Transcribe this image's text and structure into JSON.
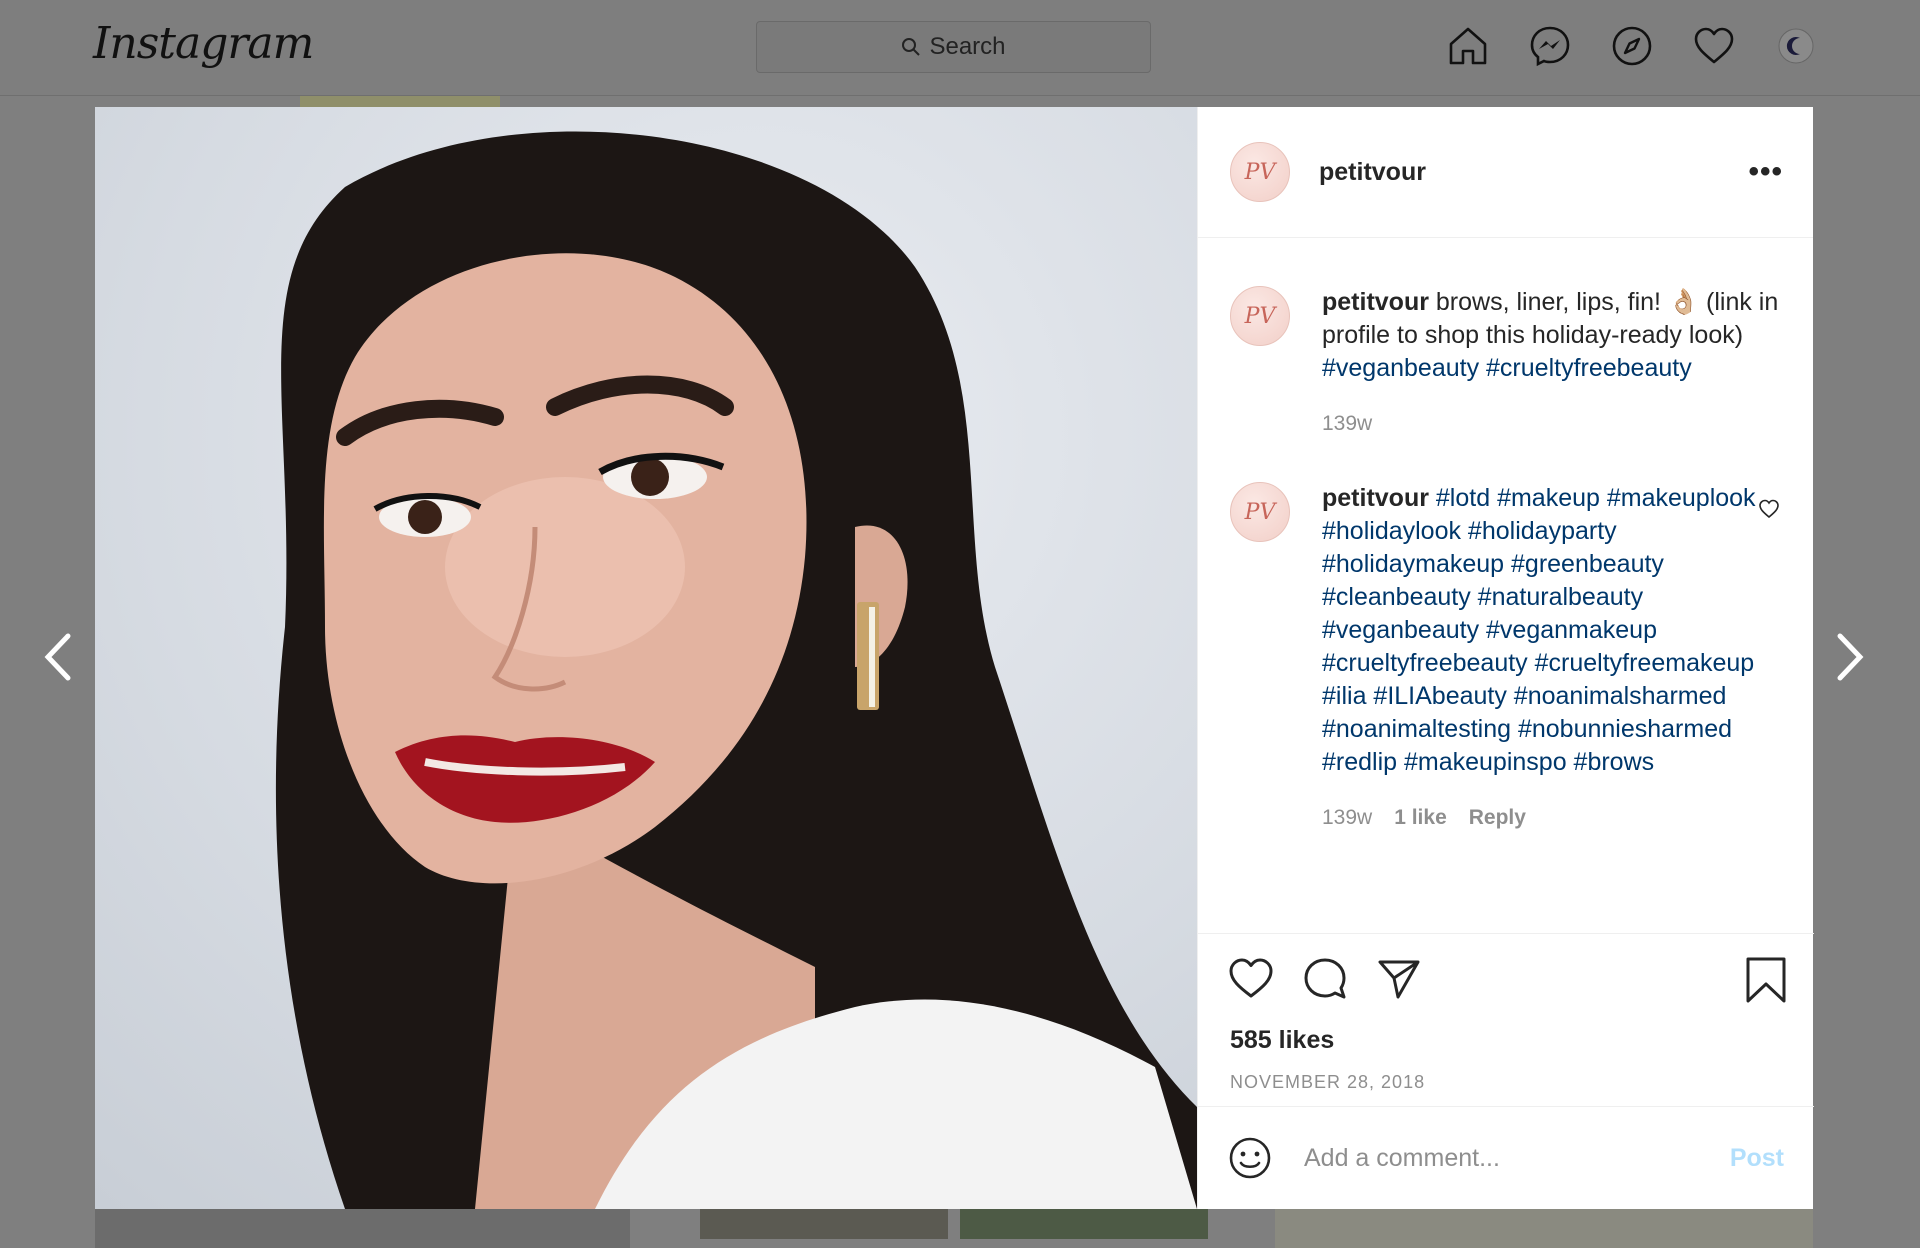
{
  "app": {
    "logo_text": "Instagram",
    "search_placeholder": "Search"
  },
  "nav": {
    "icons": [
      "home-icon",
      "messenger-icon",
      "explore-icon",
      "activity-heart-icon",
      "profile-avatar"
    ]
  },
  "post": {
    "username": "petitvour",
    "avatar_text": "PV",
    "more_label": "•••",
    "caption": {
      "username": "petitvour",
      "text": "brows, liner, lips, fin! 👌🏼 (link in profile to shop this holiday-ready look)",
      "hashtags": "#veganbeauty #crueltyfreebeauty",
      "time": "139w"
    },
    "comment": {
      "username": "petitvour",
      "hashtags": "#lotd #makeup #makeuplook #holidaylook #holidayparty #holidaymakeup #greenbeauty #cleanbeauty #naturalbeauty #veganbeauty #veganmakeup #crueltyfreebeauty #crueltyfreemakeup #ilia #ILIAbeauty #noanimalsharmed #noanimaltesting #nobunniesharmed #redlip #makeupinspo #brows",
      "time": "139w",
      "likes": "1 like",
      "reply": "Reply"
    },
    "likes": "585 likes",
    "date": "NOVEMBER 28, 2018",
    "comment_placeholder": "Add a comment...",
    "post_button": "Post"
  },
  "colors": {
    "hashtag": "#00376b",
    "post_button_disabled": "#b2dffc",
    "meta_gray": "#8e8e8e"
  }
}
